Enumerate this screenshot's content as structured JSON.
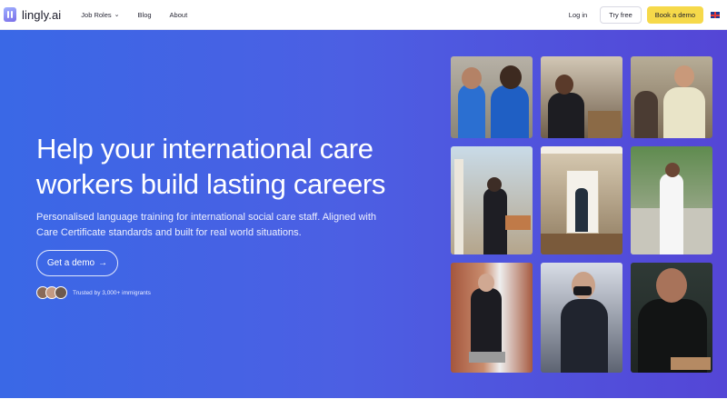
{
  "header": {
    "logo_text": "lingly.ai",
    "nav": [
      {
        "label": "Job Roles",
        "has_dropdown": true
      },
      {
        "label": "Blog"
      },
      {
        "label": "About"
      }
    ],
    "login_label": "Log in",
    "try_free_label": "Try free",
    "book_demo_label": "Book a demo",
    "flag_icon": "uk-flag-icon"
  },
  "hero": {
    "title": "Help your international care workers build lasting careers",
    "subtitle": "Personalised language training for international social care staff. Aligned with Care Certificate standards and built for real world situations.",
    "cta_label": "Get a demo",
    "cta_arrow": "→",
    "trust_text": "Trusted by 3,000+ immigrants"
  },
  "colors": {
    "hero_start": "#3a68e6",
    "hero_end": "#5446d6",
    "book_demo_bg": "#f6d94a"
  }
}
